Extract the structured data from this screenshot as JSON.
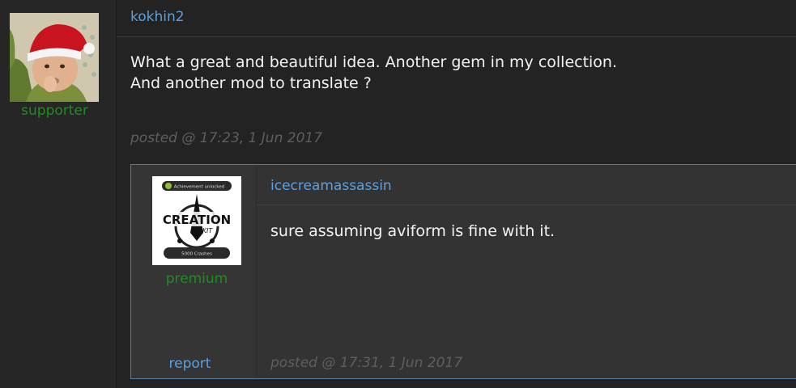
{
  "post": {
    "username": "kokhin2",
    "role": "supporter",
    "body_lines": [
      "What a great and beautiful idea. Another gem in my collection.",
      "And another mod to translate ?"
    ],
    "posted": "posted @ 17:23, 1 Jun 2017",
    "avatar_icon": "baby-santa-hat-avatar"
  },
  "reply": {
    "username": "icecreamassassin",
    "role": "premium",
    "body": "sure assuming aviform is fine with it.",
    "posted": "posted @ 17:31, 1 Jun 2017",
    "report_label": "report",
    "avatar": {
      "icon": "creation-kit-achievement-avatar",
      "badge_top": "Achievement unlocked",
      "title": "CREATION",
      "subtitle": "KIT",
      "badge_bottom": "5000 Crashes"
    }
  },
  "colors": {
    "link": "#5e9fdc",
    "role": "#1d8f1d",
    "reply_border": "#4f7ea8"
  }
}
